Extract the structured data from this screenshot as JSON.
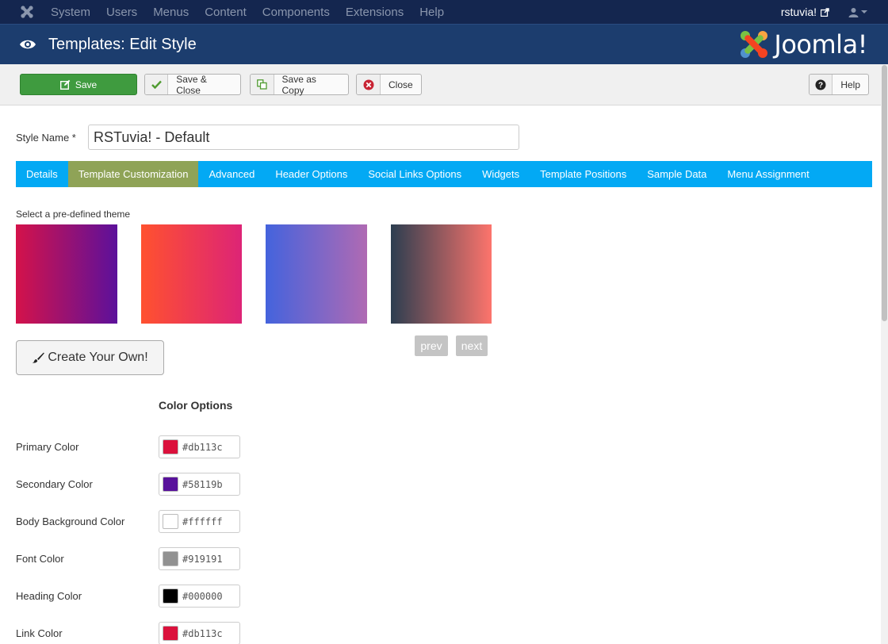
{
  "topnav": {
    "menu": [
      "System",
      "Users",
      "Menus",
      "Content",
      "Components",
      "Extensions",
      "Help"
    ],
    "user": "rstuvia!"
  },
  "header": {
    "title": "Templates: Edit Style",
    "brand": "Joomla!"
  },
  "toolbar": {
    "save": "Save",
    "save_close": "Save & Close",
    "save_copy": "Save as Copy",
    "close": "Close",
    "help": "Help"
  },
  "form": {
    "style_name_label": "Style Name *",
    "style_name_value": "RSTuvia! - Default"
  },
  "tabs": [
    "Details",
    "Template Customization",
    "Advanced",
    "Header Options",
    "Social Links Options",
    "Widgets",
    "Template Positions",
    "Sample Data",
    "Menu Assignment"
  ],
  "active_tab": "Template Customization",
  "themes": {
    "label": "Select a pre-defined theme",
    "swatches": [
      {
        "from": "#d4124a",
        "to": "#5c119b"
      },
      {
        "from": "#ff512f",
        "to": "#dd2476"
      },
      {
        "from": "#4463dd",
        "to": "#b06ab3"
      },
      {
        "from": "#2c3e50",
        "to": "#fd746c"
      }
    ],
    "prev": "prev",
    "next": "next",
    "create": "Create Your Own!"
  },
  "color_options": {
    "heading": "Color Options",
    "rows": [
      {
        "label": "Primary Color",
        "value": "#db113c"
      },
      {
        "label": "Secondary Color",
        "value": "#58119b"
      },
      {
        "label": "Body Background Color",
        "value": "#ffffff"
      },
      {
        "label": "Font Color",
        "value": "#919191"
      },
      {
        "label": "Heading Color",
        "value": "#000000"
      },
      {
        "label": "Link Color",
        "value": "#db113c"
      }
    ]
  }
}
